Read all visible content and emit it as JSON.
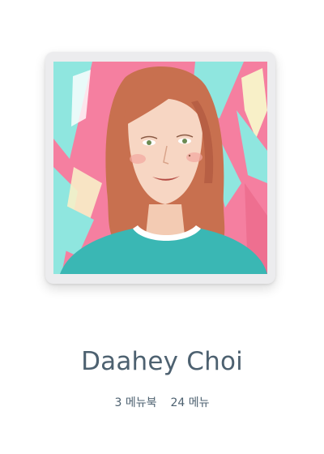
{
  "profile": {
    "name": "Daahey Choi",
    "books_count": "3",
    "books_label": "메뉴북",
    "menus_count": "24",
    "menus_label": "메뉴"
  },
  "colors": {
    "name_text": "#4d6170",
    "card_background": "#ececee",
    "portrait_background": "#f57fa0",
    "portrait_shirt": "#3ab7b4",
    "portrait_hair": "#c8704f"
  },
  "icons": {
    "avatar": "avatar-portrait"
  }
}
